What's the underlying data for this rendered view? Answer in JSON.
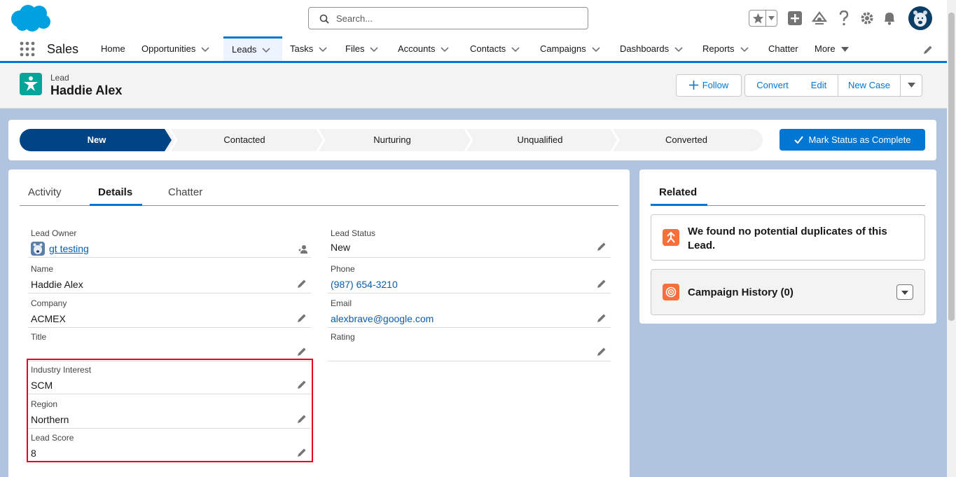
{
  "search": {
    "placeholder": "Search..."
  },
  "app": {
    "name": "Sales"
  },
  "nav": {
    "items": [
      {
        "label": "Home"
      },
      {
        "label": "Opportunities"
      },
      {
        "label": "Leads"
      },
      {
        "label": "Tasks"
      },
      {
        "label": "Files"
      },
      {
        "label": "Accounts"
      },
      {
        "label": "Contacts"
      },
      {
        "label": "Campaigns"
      },
      {
        "label": "Dashboards"
      },
      {
        "label": "Reports"
      },
      {
        "label": "Chatter"
      },
      {
        "label": "More"
      }
    ]
  },
  "record": {
    "object_label": "Lead",
    "name": "Haddie Alex",
    "buttons": {
      "follow": "Follow",
      "convert": "Convert",
      "edit": "Edit",
      "new_case": "New Case"
    }
  },
  "path": {
    "stages": [
      "New",
      "Contacted",
      "Nurturing",
      "Unqualified",
      "Converted"
    ],
    "current": "New",
    "mark_button": "Mark Status as Complete"
  },
  "tabs": {
    "activity": "Activity",
    "details": "Details",
    "chatter": "Chatter"
  },
  "fields": {
    "lead_owner": {
      "label": "Lead Owner",
      "value": "gt testing"
    },
    "name": {
      "label": "Name",
      "value": "Haddie Alex"
    },
    "company": {
      "label": "Company",
      "value": "ACMEX"
    },
    "title": {
      "label": "Title",
      "value": ""
    },
    "industry_interest": {
      "label": "Industry Interest",
      "value": "SCM"
    },
    "region": {
      "label": "Region",
      "value": "Northern"
    },
    "lead_score": {
      "label": "Lead Score",
      "value": "8"
    },
    "lead_status": {
      "label": "Lead Status",
      "value": "New"
    },
    "phone": {
      "label": "Phone",
      "value": "(987) 654-3210"
    },
    "email": {
      "label": "Email",
      "value": "alexbrave@google.com"
    },
    "rating": {
      "label": "Rating",
      "value": ""
    }
  },
  "related": {
    "tab": "Related",
    "duplicates": "We found no potential duplicates of this Lead.",
    "campaign_history": "Campaign History (0)"
  },
  "colors": {
    "brand": "#0176d3",
    "highlight": "#ea001e",
    "lead_icon": "#06a59a"
  }
}
